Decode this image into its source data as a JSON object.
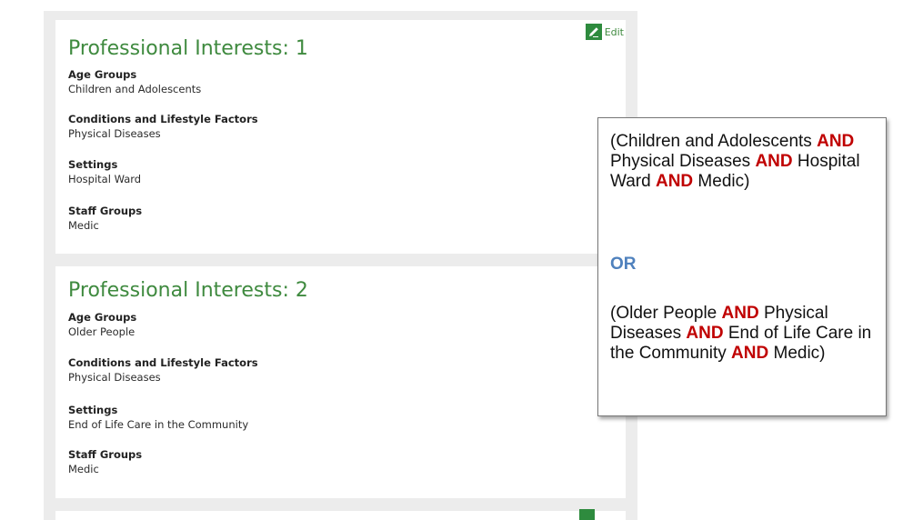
{
  "edit_label": "Edit",
  "cards": [
    {
      "title": "Professional Interests: 1",
      "fields": [
        {
          "label": "Age Groups",
          "value": "Children and Adolescents"
        },
        {
          "label": "Conditions and Lifestyle Factors",
          "value": "Physical Diseases"
        },
        {
          "label": "Settings",
          "value": "Hospital Ward"
        },
        {
          "label": "Staff Groups",
          "value": "Medic"
        }
      ]
    },
    {
      "title": "Professional Interests: 2",
      "fields": [
        {
          "label": "Age Groups",
          "value": "Older People"
        },
        {
          "label": "Conditions and Lifestyle Factors",
          "value": "Physical Diseases"
        },
        {
          "label": "Settings",
          "value": "End of Life Care in the Community"
        },
        {
          "label": "Staff Groups",
          "value": "Medic"
        }
      ]
    }
  ],
  "callout": {
    "clause1": [
      {
        "t": "(Children and Adolescents "
      },
      {
        "t": "AND",
        "kw": true
      },
      {
        "t": " Physical Diseases "
      },
      {
        "t": "AND",
        "kw": true
      },
      {
        "t": " Hospital Ward "
      },
      {
        "t": "AND",
        "kw": true
      },
      {
        "t": " Medic)"
      }
    ],
    "or_label": "OR",
    "clause2": [
      {
        "t": "(Older People "
      },
      {
        "t": "AND",
        "kw": true
      },
      {
        "t": " Physical Diseases "
      },
      {
        "t": "AND",
        "kw": true
      },
      {
        "t": " End of Life Care in the Community "
      },
      {
        "t": "AND",
        "kw": true
      },
      {
        "t": " Medic)"
      }
    ]
  },
  "colors": {
    "title_green": "#3f8a3f",
    "edit_icon_bg": "#2e8b3e",
    "keyword_red": "#c00000",
    "or_blue": "#4f81bd"
  }
}
